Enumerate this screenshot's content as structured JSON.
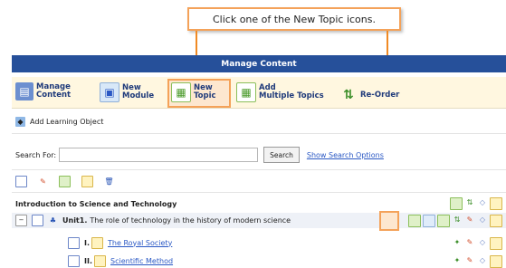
{
  "callout": {
    "text": "Click one of the New Topic icons."
  },
  "panel": {
    "title": "Manage Content",
    "toolbar": [
      {
        "label1": "Manage",
        "label2": "Content",
        "icon": "manage-content-icon"
      },
      {
        "label1": "New",
        "label2": "Module",
        "icon": "new-module-icon"
      },
      {
        "label1": "New",
        "label2": "Topic",
        "icon": "new-topic-icon"
      },
      {
        "label1": "Add",
        "label2": "Multiple Topics",
        "icon": "add-multiple-topics-icon"
      },
      {
        "label1": "Re-Order",
        "label2": "",
        "icon": "reorder-icon"
      }
    ],
    "add_learning_object": "Add Learning Object",
    "search": {
      "label": "Search For:",
      "value": "",
      "button": "Search",
      "options_link": "Show Search Options"
    },
    "course_title": "Introduction to Science and Technology",
    "unit": {
      "prefix": "Unit1.",
      "text": "The role of technology in the history of modern science"
    },
    "topics": [
      {
        "num": "I.",
        "title": "The Royal Society"
      },
      {
        "num": "II.",
        "title": "Scientific Method"
      }
    ]
  },
  "colors": {
    "header": "#26509a",
    "highlight": "#f4a259",
    "toolbar_bg": "#fff7e0",
    "link": "#2a58c4"
  }
}
